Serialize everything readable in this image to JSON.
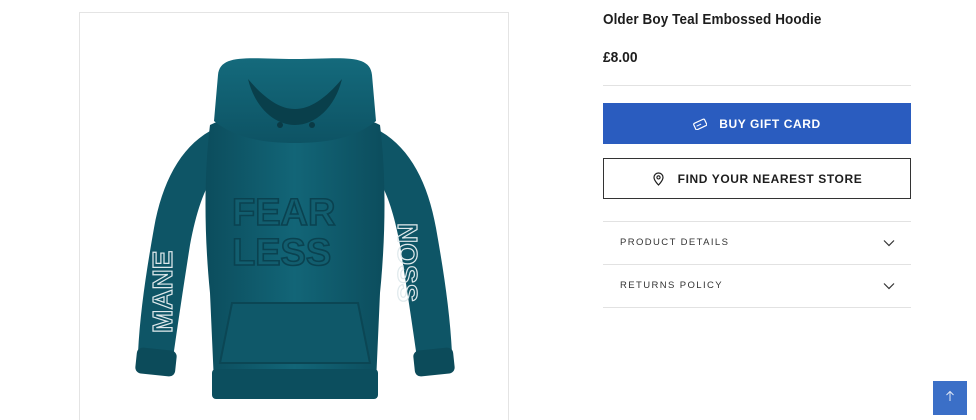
{
  "product": {
    "title": "Older Boy Teal Embossed Hoodie",
    "price": "£8.00",
    "image_alt": "Teal hoodie with embossed FEARLESS text"
  },
  "actions": {
    "gift_card_label": "BUY GIFT CARD",
    "gift_card_icon": "gift-card-icon",
    "store_label": "FIND YOUR NEAREST STORE",
    "store_icon": "map-pin-icon"
  },
  "accordions": [
    {
      "label": "PRODUCT DETAILS",
      "icon": "chevron-down-icon"
    },
    {
      "label": "RETURNS POLICY",
      "icon": "chevron-down-icon"
    }
  ],
  "scroll_top": {
    "icon": "arrow-up-icon"
  },
  "colors": {
    "primary_button": "#2a5cbf",
    "scroll_button": "#3b6fc7",
    "hoodie": "#0f5a6b"
  }
}
